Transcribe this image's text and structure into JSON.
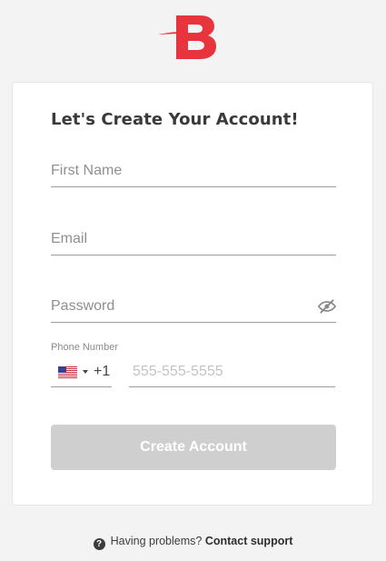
{
  "brand": {
    "logo_icon": "brand-b-logo",
    "accent_color": "#e8343c"
  },
  "form": {
    "title": "Let's Create Your Account!",
    "first_name": {
      "placeholder": "First Name",
      "value": ""
    },
    "email": {
      "placeholder": "Email",
      "value": ""
    },
    "password": {
      "placeholder": "Password",
      "value": "",
      "toggle_icon": "eye-slash-icon"
    },
    "phone": {
      "label": "Phone Number",
      "country_flag": "us-flag-icon",
      "dial_code": "+1",
      "placeholder": "555-555-5555",
      "value": ""
    },
    "submit_label": "Create Account"
  },
  "help": {
    "icon": "question-circle-icon",
    "text": "Having problems?",
    "link_label": "Contact support"
  }
}
